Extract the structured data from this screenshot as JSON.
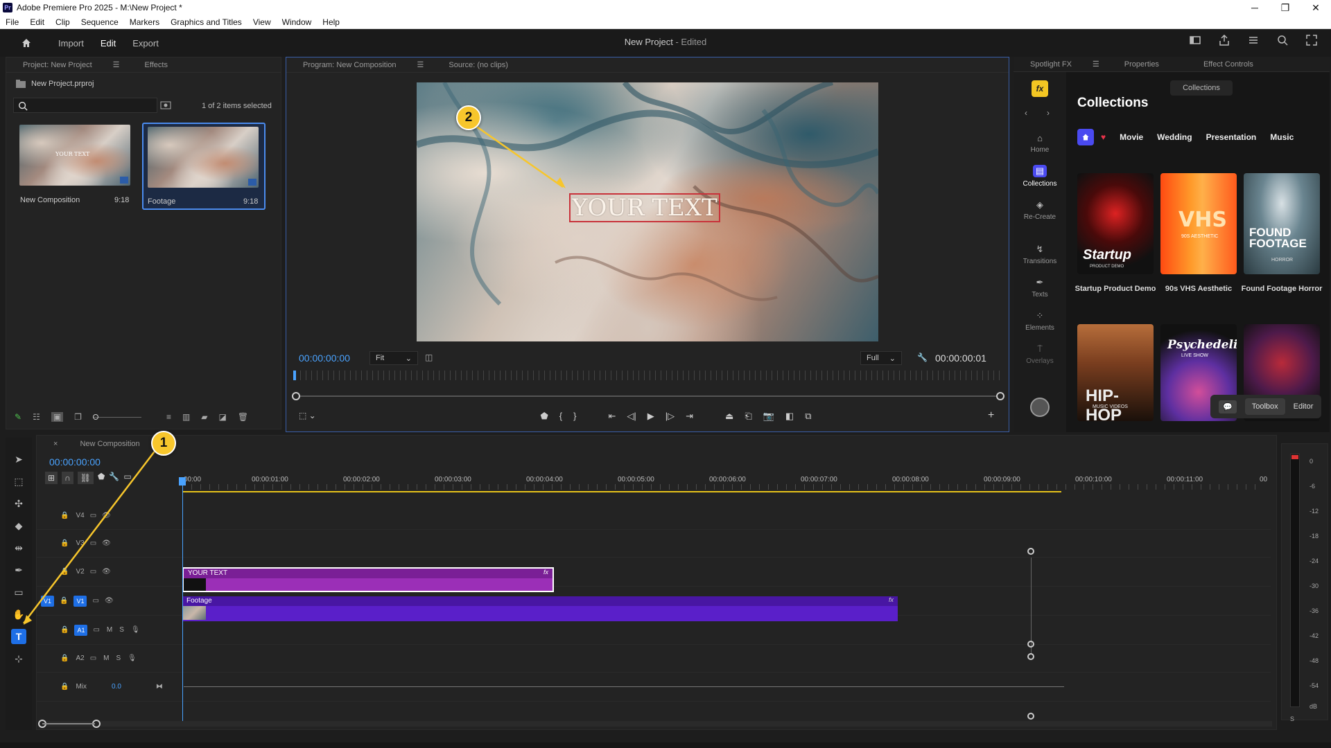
{
  "app": {
    "window_title": "Adobe Premiere Pro 2025 - M:\\New Project *",
    "logo": "Pr",
    "minimize": "─",
    "maximize": "❐",
    "close": "✕"
  },
  "menu": [
    "File",
    "Edit",
    "Clip",
    "Sequence",
    "Markers",
    "Graphics and Titles",
    "View",
    "Window",
    "Help"
  ],
  "workspace": {
    "tabs": [
      "Import",
      "Edit",
      "Export"
    ],
    "active_tab": "Edit",
    "project_title": "New Project",
    "edited": "- Edited"
  },
  "project_panel": {
    "tabs": [
      "Project: New Project",
      "Effects"
    ],
    "file": "New Project.prproj",
    "selection": "1 of 2 items selected",
    "items": [
      {
        "name": "New Composition",
        "duration": "9:18",
        "overlay_text": "YOUR TEXT"
      },
      {
        "name": "Footage",
        "duration": "9:18"
      }
    ]
  },
  "program_monitor": {
    "tabs": [
      "Program: New Composition",
      "Source: (no clips)"
    ],
    "overlay_text": "YOUR TEXT",
    "current_time": "00:00:00:00",
    "fit": "Fit",
    "resolution": "Full",
    "duration": "00:00:00:01"
  },
  "spotlight": {
    "tabs": [
      "Spotlight FX",
      "Properties",
      "Effect Controls"
    ],
    "fx_logo": "fx",
    "title": "Collections",
    "collections_button": "Collections",
    "nav": [
      "Home",
      "Collections",
      "Re-Create",
      "Transitions",
      "Texts",
      "Elements",
      "Overlays"
    ],
    "active_nav": "Collections",
    "categories": [
      "Movie",
      "Wedding",
      "Presentation",
      "Music"
    ],
    "cards": [
      {
        "label": "Startup Product Demo",
        "art": "Startup"
      },
      {
        "label": "90s VHS Aesthetic",
        "art": "VHS"
      },
      {
        "label": "Found Footage Horror",
        "art": "FOUND FOOTAGE"
      },
      {
        "label": "",
        "art": "HIP-HOP"
      },
      {
        "label": "",
        "art": "Psychedelic"
      },
      {
        "label": "",
        "art": ""
      }
    ],
    "card_subtitles": [
      "PRODUCT DEMO",
      "90S AESTHETIC",
      "HORROR",
      "MUSIC VIDEOS",
      "LIVE SHOW"
    ],
    "toolbox": "Toolbox",
    "editor": "Editor"
  },
  "timeline": {
    "sequence": "New Composition",
    "current_time": "00:00:00:00",
    "ruler": [
      "00:00",
      "00:00:01:00",
      "00:00:02:00",
      "00:00:03:00",
      "00:00:04:00",
      "00:00:05:00",
      "00:00:06:00",
      "00:00:07:00",
      "00:00:08:00",
      "00:00:09:00",
      "00:00:10:00",
      "00:00:11:00",
      "00"
    ],
    "tracks": [
      "V4",
      "V3",
      "V2",
      "V1",
      "A1",
      "A2",
      "Mix"
    ],
    "source_patch": "V1",
    "audio_toggles": [
      "M",
      "S"
    ],
    "mix_value": "0.0",
    "clips": [
      {
        "name": "YOUR TEXT",
        "track": "V2",
        "color": "#9b2fb7"
      },
      {
        "name": "Footage",
        "track": "V1",
        "color": "#5a1fc9"
      }
    ]
  },
  "meter_labels": [
    "0",
    "-6",
    "-12",
    "-18",
    "-24",
    "-30",
    "-36",
    "-42",
    "-48",
    "-54",
    "dB"
  ],
  "meter_solo": "S",
  "annotations": [
    "1",
    "2"
  ]
}
